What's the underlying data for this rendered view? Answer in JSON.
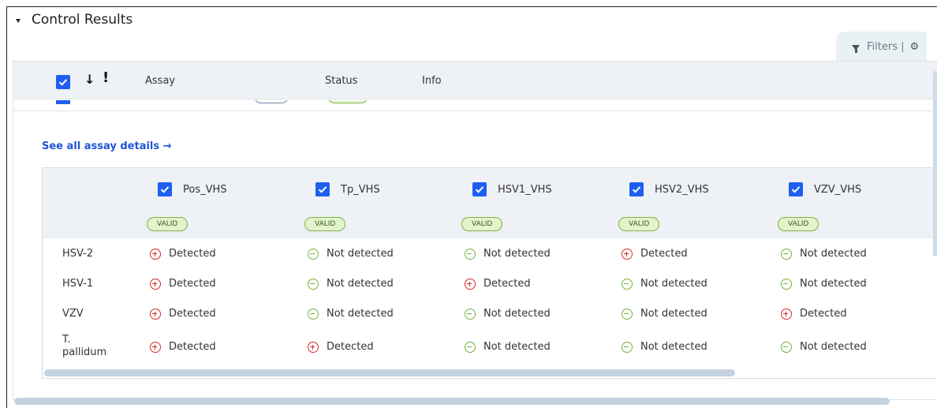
{
  "section": {
    "title": "Control Results"
  },
  "filters": {
    "label": "Filters |"
  },
  "table_header": {
    "sort_symbol": "↓",
    "flag_symbol": "!",
    "columns": [
      "Assay",
      "Status",
      "Info"
    ]
  },
  "see_all": {
    "label": "See all assay details →"
  },
  "assays": [
    {
      "name": "Pos_VHS",
      "status": "VALID"
    },
    {
      "name": "Tp_VHS",
      "status": "VALID"
    },
    {
      "name": "HSV1_VHS",
      "status": "VALID"
    },
    {
      "name": "HSV2_VHS",
      "status": "VALID"
    },
    {
      "name": "VZV_VHS",
      "status": "VALID"
    }
  ],
  "results": {
    "rows": [
      {
        "label": "HSV-2",
        "cells": [
          {
            "icon": "plus-circle-icon",
            "text": "Detected"
          },
          {
            "icon": "minus-circle-icon",
            "text": "Not detected"
          },
          {
            "icon": "minus-circle-icon",
            "text": "Not detected"
          },
          {
            "icon": "plus-circle-icon",
            "text": "Detected"
          },
          {
            "icon": "minus-circle-icon",
            "text": "Not detected"
          }
        ]
      },
      {
        "label": "HSV-1",
        "cells": [
          {
            "icon": "plus-circle-icon",
            "text": "Detected"
          },
          {
            "icon": "minus-circle-icon",
            "text": "Not detected"
          },
          {
            "icon": "plus-circle-icon",
            "text": "Detected"
          },
          {
            "icon": "minus-circle-icon",
            "text": "Not detected"
          },
          {
            "icon": "minus-circle-icon",
            "text": "Not detected"
          }
        ]
      },
      {
        "label": "VZV",
        "cells": [
          {
            "icon": "plus-circle-icon",
            "text": "Detected"
          },
          {
            "icon": "minus-circle-icon",
            "text": "Not detected"
          },
          {
            "icon": "minus-circle-icon",
            "text": "Not detected"
          },
          {
            "icon": "minus-circle-icon",
            "text": "Not detected"
          },
          {
            "icon": "plus-circle-icon",
            "text": "Detected"
          }
        ]
      },
      {
        "label": "T. pallidum",
        "cells": [
          {
            "icon": "plus-circle-icon",
            "text": "Detected"
          },
          {
            "icon": "plus-circle-icon",
            "text": "Detected"
          },
          {
            "icon": "minus-circle-icon",
            "text": "Not detected"
          },
          {
            "icon": "minus-circle-icon",
            "text": "Not detected"
          },
          {
            "icon": "minus-circle-icon",
            "text": "Not detected"
          }
        ]
      }
    ]
  },
  "colors": {
    "accent": "#1e5ff0",
    "detected": "#d42a2a",
    "not_detected": "#72b33a",
    "valid_bg": "#e3f3cc"
  }
}
